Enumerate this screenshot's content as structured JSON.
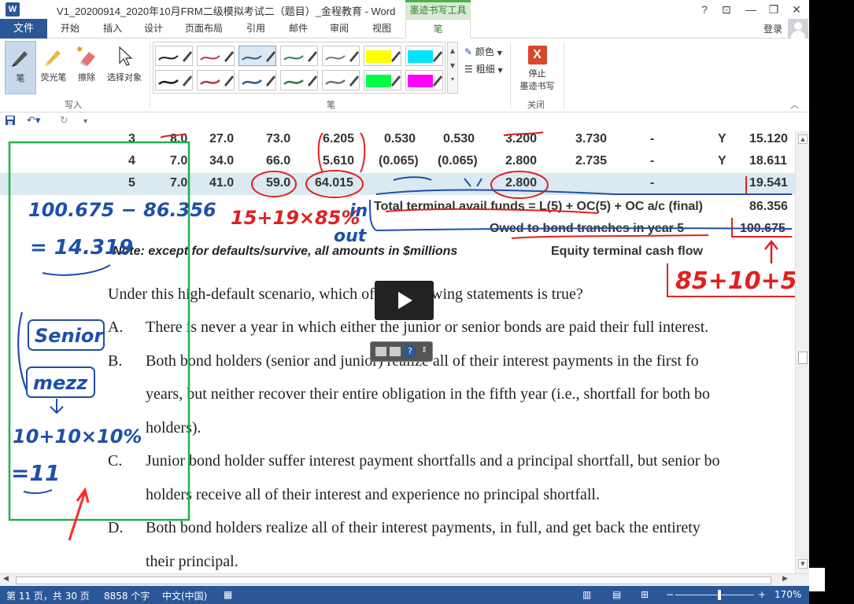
{
  "titlebar": {
    "logo": "W",
    "title": "V1_20200914_2020年10月FRM二级模拟考试二（题目）_金程教育 - Word",
    "context_tab": "墨迹书写工具",
    "help": "?",
    "ribbon_display": "⊡",
    "minimize": "—",
    "restore": "❐",
    "close": "✕"
  },
  "tabs": {
    "file": "文件",
    "items": [
      "开始",
      "插入",
      "设计",
      "页面布局",
      "引用",
      "邮件",
      "审阅",
      "视图",
      "笔"
    ],
    "signin": "登录"
  },
  "ribbon": {
    "pen": "笔",
    "highlighter": "荧光笔",
    "eraser": "擦除",
    "select": "选择对象",
    "group_write": "写入",
    "group_pens": "笔",
    "color": "颜色",
    "thickness": "粗细",
    "stop_line1": "停止",
    "stop_line2": "墨迹书写",
    "group_close": "关闭",
    "stop_icon": "X",
    "swatch_colors": [
      "#222222",
      "#b83a4b",
      "#2f5f8a",
      "#2e7d4f",
      "#777777",
      "#ffff00",
      "#00e5ff",
      "#222222",
      "#b83a4b",
      "#2f5f8a",
      "#2e7d4f",
      "#777777",
      "#00ff44",
      "#ff00ff"
    ]
  },
  "document": {
    "rows": [
      {
        "n": "3",
        "a": "8.0",
        "b": "27.0",
        "c": "73.0",
        "d": "6.205",
        "e": "0.530",
        "f": "0.530",
        "g": "3.200",
        "h": "3.730",
        "i": "-",
        "j": "Y",
        "k": "15.120"
      },
      {
        "n": "4",
        "a": "7.0",
        "b": "34.0",
        "c": "66.0",
        "d": "5.610",
        "e": "(0.065)",
        "f": "(0.065)",
        "g": "2.800",
        "h": "2.735",
        "i": "-",
        "j": "Y",
        "k": "18.611"
      },
      {
        "n": "5",
        "a": "7.0",
        "b": "41.0",
        "c": "59.0",
        "d": "64.015",
        "g": "2.800",
        "i": "-",
        "k": "19.541"
      }
    ],
    "total_label": "Total terminal avail funds = L(5) + OC(5) + OC a/c (final)",
    "total_value": "86.356",
    "owed_label": "Owed to bond tranches in year 5",
    "owed_value": "100.675",
    "note": "Note: except for defaults/survive, all amounts in $millions",
    "equity_label": "Equity terminal cash flow",
    "question": "Under this high-default scenario, which of the following statements is true?",
    "options": [
      {
        "letter": "A.",
        "lines": [
          "There is never a year in which either the junior or senior bonds are paid their full interest."
        ]
      },
      {
        "letter": "B.",
        "lines": [
          "Both bond holders (senior and junior) realize all of their interest payments in the first fo",
          "years, but neither recover their entire obligation in the fifth year (i.e., shortfall for both bo",
          "holders)."
        ]
      },
      {
        "letter": "C.",
        "lines": [
          "Junior bond holder suffer interest payment shortfalls and a principal shortfall, but senior bo",
          "holders receive all of their interest and experience no principal shortfall."
        ]
      },
      {
        "letter": "D.",
        "lines": [
          "Both bond holders realize all of their interest payments, in full, and get back the entirety",
          "their principal."
        ]
      }
    ],
    "ink": {
      "calc1": "100.675 − 86.356",
      "calc2": "= 14.319",
      "formula": "15+19×85%",
      "in": "in",
      "out": "out",
      "senior": "Senior",
      "mezz": "mezz",
      "calc3": "10+10×10%",
      "calc4": "=11",
      "right": "85+10+5."
    }
  },
  "status": {
    "page": "第 11 页，共 30 页",
    "words": "8858 个字",
    "lang": "中文(中国)",
    "zoom_minus": "−",
    "zoom_plus": "+",
    "zoom": "170%",
    "zoom_level": 0.56
  }
}
